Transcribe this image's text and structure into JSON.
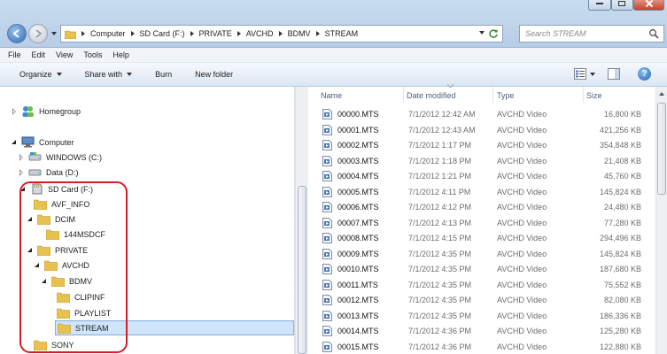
{
  "address": {
    "crumbs": [
      "Computer",
      "SD Card (F:)",
      "PRIVATE",
      "AVCHD",
      "BDMV",
      "STREAM"
    ]
  },
  "search": {
    "placeholder": "Search STREAM"
  },
  "menu": [
    "File",
    "Edit",
    "View",
    "Tools",
    "Help"
  ],
  "toolbar": {
    "organize": "Organize",
    "share_with": "Share with",
    "burn": "Burn",
    "new_folder": "New folder"
  },
  "nav": {
    "homegroup": "Homegroup",
    "computer": "Computer",
    "windows": "WINDOWS (C:)",
    "data": "Data (D:)",
    "sdcard": "SD Card (F:)",
    "avf_info": "AVF_INFO",
    "dcim": "DCIM",
    "msdcf": "144MSDCF",
    "private": "PRIVATE",
    "avchd": "AVCHD",
    "bdmv": "BDMV",
    "clipinf": "CLIPINF",
    "playlist": "PLAYLIST",
    "stream": "STREAM",
    "sony": "SONY"
  },
  "columns": {
    "name": "Name",
    "date": "Date modified",
    "type": "Type",
    "size": "Size"
  },
  "files": [
    {
      "name": "00000.MTS",
      "date": "7/1/2012 12:42 AM",
      "type": "AVCHD Video",
      "size": "16,800 KB"
    },
    {
      "name": "00001.MTS",
      "date": "7/1/2012 12:43 AM",
      "type": "AVCHD Video",
      "size": "421,256 KB"
    },
    {
      "name": "00002.MTS",
      "date": "7/1/2012 1:17 PM",
      "type": "AVCHD Video",
      "size": "354,848 KB"
    },
    {
      "name": "00003.MTS",
      "date": "7/1/2012 1:18 PM",
      "type": "AVCHD Video",
      "size": "21,408 KB"
    },
    {
      "name": "00004.MTS",
      "date": "7/1/2012 1:21 PM",
      "type": "AVCHD Video",
      "size": "45,760 KB"
    },
    {
      "name": "00005.MTS",
      "date": "7/1/2012 4:11 PM",
      "type": "AVCHD Video",
      "size": "145,824 KB"
    },
    {
      "name": "00006.MTS",
      "date": "7/1/2012 4:12 PM",
      "type": "AVCHD Video",
      "size": "24,480 KB"
    },
    {
      "name": "00007.MTS",
      "date": "7/1/2012 4:13 PM",
      "type": "AVCHD Video",
      "size": "77,280 KB"
    },
    {
      "name": "00008.MTS",
      "date": "7/1/2012 4:15 PM",
      "type": "AVCHD Video",
      "size": "294,496 KB"
    },
    {
      "name": "00009.MTS",
      "date": "7/1/2012 4:35 PM",
      "type": "AVCHD Video",
      "size": "145,824 KB"
    },
    {
      "name": "00010.MTS",
      "date": "7/1/2012 4:35 PM",
      "type": "AVCHD Video",
      "size": "187,680 KB"
    },
    {
      "name": "00011.MTS",
      "date": "7/1/2012 4:35 PM",
      "type": "AVCHD Video",
      "size": "75,552 KB"
    },
    {
      "name": "00012.MTS",
      "date": "7/1/2012 4:35 PM",
      "type": "AVCHD Video",
      "size": "82,080 KB"
    },
    {
      "name": "00013.MTS",
      "date": "7/1/2012 4:35 PM",
      "type": "AVCHD Video",
      "size": "186,336 KB"
    },
    {
      "name": "00014.MTS",
      "date": "7/1/2012 4:36 PM",
      "type": "AVCHD Video",
      "size": "125,280 KB"
    },
    {
      "name": "00015.MTS",
      "date": "7/1/2012 4:36 PM",
      "type": "AVCHD Video",
      "size": "122,880 KB"
    }
  ],
  "colors": {
    "highlight_box": "#d51e25",
    "selection": "#cfe5fb",
    "folder": "#e8c250"
  }
}
